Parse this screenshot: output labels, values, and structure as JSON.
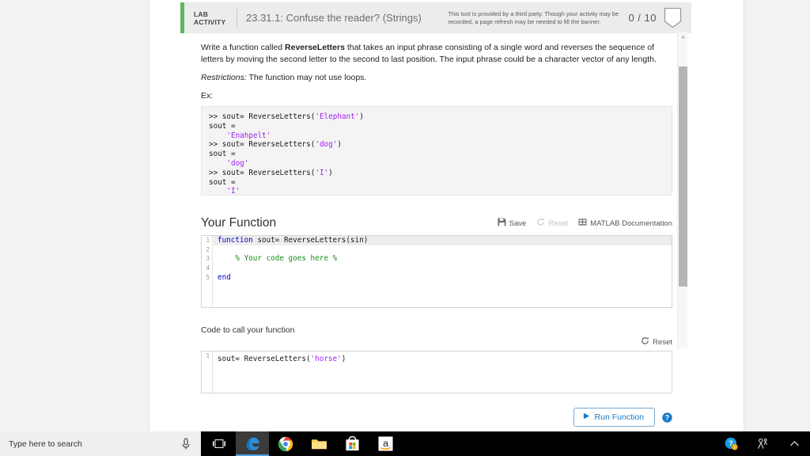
{
  "header": {
    "lab_tag_line1": "LAB",
    "lab_tag_line2": "ACTIVITY",
    "title": "23.31.1: Confuse the reader? (Strings)",
    "disclaimer_line1": "This tool is provided by a third party. Though your activity may be",
    "disclaimer_line2": "recorded, a page refresh may be needed to fill the banner.",
    "score": "0 / 10",
    "accent_color": "#5cb85c",
    "badge_icon": "shield-badge-icon"
  },
  "prompt": {
    "text_before_bold": "Write a function called ",
    "bold_name": "ReverseLetters",
    "text_after_bold": " that takes an input phrase consisting of a single word and reverses the sequence of letters by moving the second letter to the second to last position.  The input phrase could be a character vector of any length.",
    "restrictions_label": "Restrictions:",
    "restrictions_text": " The function may not use loops.",
    "ex_label": "Ex:"
  },
  "example": {
    "lines": [
      [
        {
          "t": ">> sout= ReverseLetters(",
          "c": "plain"
        },
        {
          "t": "'Elephant'",
          "c": "str"
        },
        {
          "t": ")",
          "c": "plain"
        }
      ],
      [
        {
          "t": "sout =",
          "c": "plain"
        }
      ],
      [
        {
          "t": "    ",
          "c": "plain"
        },
        {
          "t": "'Enahpelt'",
          "c": "str"
        }
      ],
      [
        {
          "t": ">> sout= ReverseLetters(",
          "c": "plain"
        },
        {
          "t": "'dog'",
          "c": "str"
        },
        {
          "t": ")",
          "c": "plain"
        }
      ],
      [
        {
          "t": "sout =",
          "c": "plain"
        }
      ],
      [
        {
          "t": "    ",
          "c": "plain"
        },
        {
          "t": "'dog'",
          "c": "str"
        }
      ],
      [
        {
          "t": ">> sout= ReverseLetters(",
          "c": "plain"
        },
        {
          "t": "'I'",
          "c": "str"
        },
        {
          "t": ")",
          "c": "plain"
        }
      ],
      [
        {
          "t": "sout =",
          "c": "plain"
        }
      ],
      [
        {
          "t": "    ",
          "c": "plain"
        },
        {
          "t": "'I'",
          "c": "str"
        }
      ]
    ]
  },
  "your_function": {
    "title": "Your Function",
    "save_label": "Save",
    "save_icon": "floppy-disk-icon",
    "reset_label": "Reset",
    "reset_icon": "refresh-circular-arrow-icon",
    "reset_disabled": true,
    "docs_label": "MATLAB Documentation",
    "docs_icon": "book-grid-icon",
    "line_numbers": [
      "1",
      "2",
      "3",
      "4",
      "5"
    ],
    "code_lines": [
      [
        {
          "t": "function",
          "c": "kw"
        },
        {
          "t": " sout= ReverseLetters(sin)",
          "c": "plain"
        }
      ],
      [],
      [
        {
          "t": "    % Your code goes here %",
          "c": "cm"
        }
      ],
      [],
      [
        {
          "t": "end",
          "c": "kw"
        }
      ]
    ],
    "highlight_line": 1
  },
  "call_function": {
    "title": "Code to call your function",
    "reset_label": "Reset",
    "reset_icon": "refresh-circular-arrow-icon",
    "line_numbers": [
      "1"
    ],
    "code_lines": [
      [
        {
          "t": "sout= ReverseLetters(",
          "c": "plain"
        },
        {
          "t": "'horse'",
          "c": "str"
        },
        {
          "t": ")",
          "c": "plain"
        }
      ]
    ]
  },
  "run": {
    "label": "Run Function",
    "play_icon": "play-triangle-icon",
    "help_icon": "question-mark-circle-icon",
    "accent_color": "#1a7bc4"
  },
  "scrollbar": {
    "up_icon": "chevron-up-icon"
  },
  "taskbar": {
    "search_placeholder": "Type here to search",
    "mic_icon": "microphone-icon",
    "items": [
      {
        "name": "task-view-icon",
        "label": "Task View"
      },
      {
        "name": "edge-icon",
        "label": "Microsoft Edge"
      },
      {
        "name": "chrome-icon",
        "label": "Google Chrome"
      },
      {
        "name": "file-explorer-icon",
        "label": "File Explorer"
      },
      {
        "name": "microsoft-store-icon",
        "label": "Microsoft Store"
      },
      {
        "name": "amazon-icon",
        "label": "Amazon"
      }
    ],
    "tray": [
      {
        "name": "help-warning-icon",
        "label": "Help"
      },
      {
        "name": "people-icon",
        "label": "People"
      },
      {
        "name": "show-hidden-icons-chevron-icon",
        "label": "Show hidden icons"
      }
    ]
  }
}
